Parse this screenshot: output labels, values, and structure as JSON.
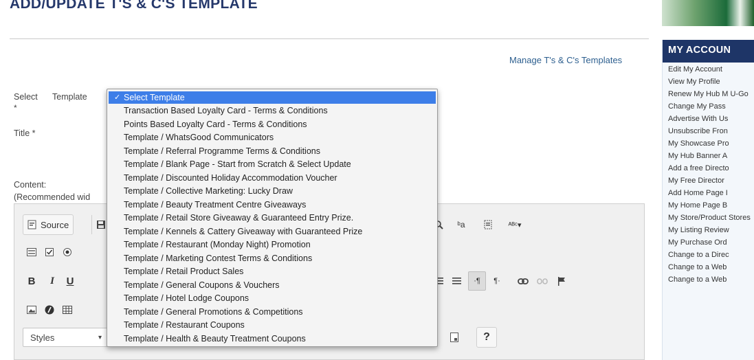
{
  "page": {
    "title": "ADD/UPDATE T'S & C'S TEMPLATE",
    "manage_link": "Manage T's & C's Templates"
  },
  "form": {
    "select_label": "Select",
    "template_label": "Template",
    "required_mark": "*",
    "title_label": "Title *",
    "content_label": "Content:",
    "recommended_label": "(Recommended wid"
  },
  "editor": {
    "source_label": "Source",
    "styles_label": "Styles",
    "help_label": "?"
  },
  "dropdown": {
    "selected": "Select Template",
    "options": [
      "Select Template",
      "Transaction Based Loyalty Card - Terms & Conditions",
      "Points Based Loyalty Card - Terms & Conditions",
      "Template / WhatsGood Communicators",
      "Template / Referral Programme Terms & Conditions",
      "Template / Blank Page - Start from Scratch & Select Update",
      "Template / Discounted Holiday Accommodation Voucher",
      "Template / Collective Marketing: Lucky Draw",
      "Template / Beauty Treatment Centre Giveaways",
      "Template / Retail Store Giveaway & Guaranteed Entry Prize.",
      "Template / Kennels & Cattery Giveaway with Guaranteed Prize",
      "Template / Restaurant (Monday Night) Promotion",
      "Template / Marketing Contest Terms & Conditions",
      "Template / Retail Product Sales",
      "Template / General Coupons & Vouchers",
      "Template / Hotel Lodge Coupons",
      "Template / General Promotions & Competitions",
      "Template / Restaurant Coupons",
      "Template / Health & Beauty Treatment Coupons"
    ]
  },
  "sidebar": {
    "heading": "MY ACCOUN",
    "items": [
      "Edit My Account",
      "View My Profile",
      "Renew My Hub M U-Go",
      "Change My Pass",
      "Advertise With Us",
      "Unsubscribe Fron",
      "My Showcase Pro",
      "My Hub Banner A",
      "Add a free Directo",
      "My Free Director",
      "Add Home Page I",
      "My Home Page B",
      "My Store/Product Stores",
      "My Listing Review",
      "My Purchase Ord",
      "Change to a Direc",
      "Change to a Web",
      "Change to a Web"
    ]
  },
  "colors": {
    "title": "#25386b",
    "link": "#2d5f8f",
    "dropdown_highlight": "#3d7ee8",
    "sidebar_header": "#1e3567"
  }
}
